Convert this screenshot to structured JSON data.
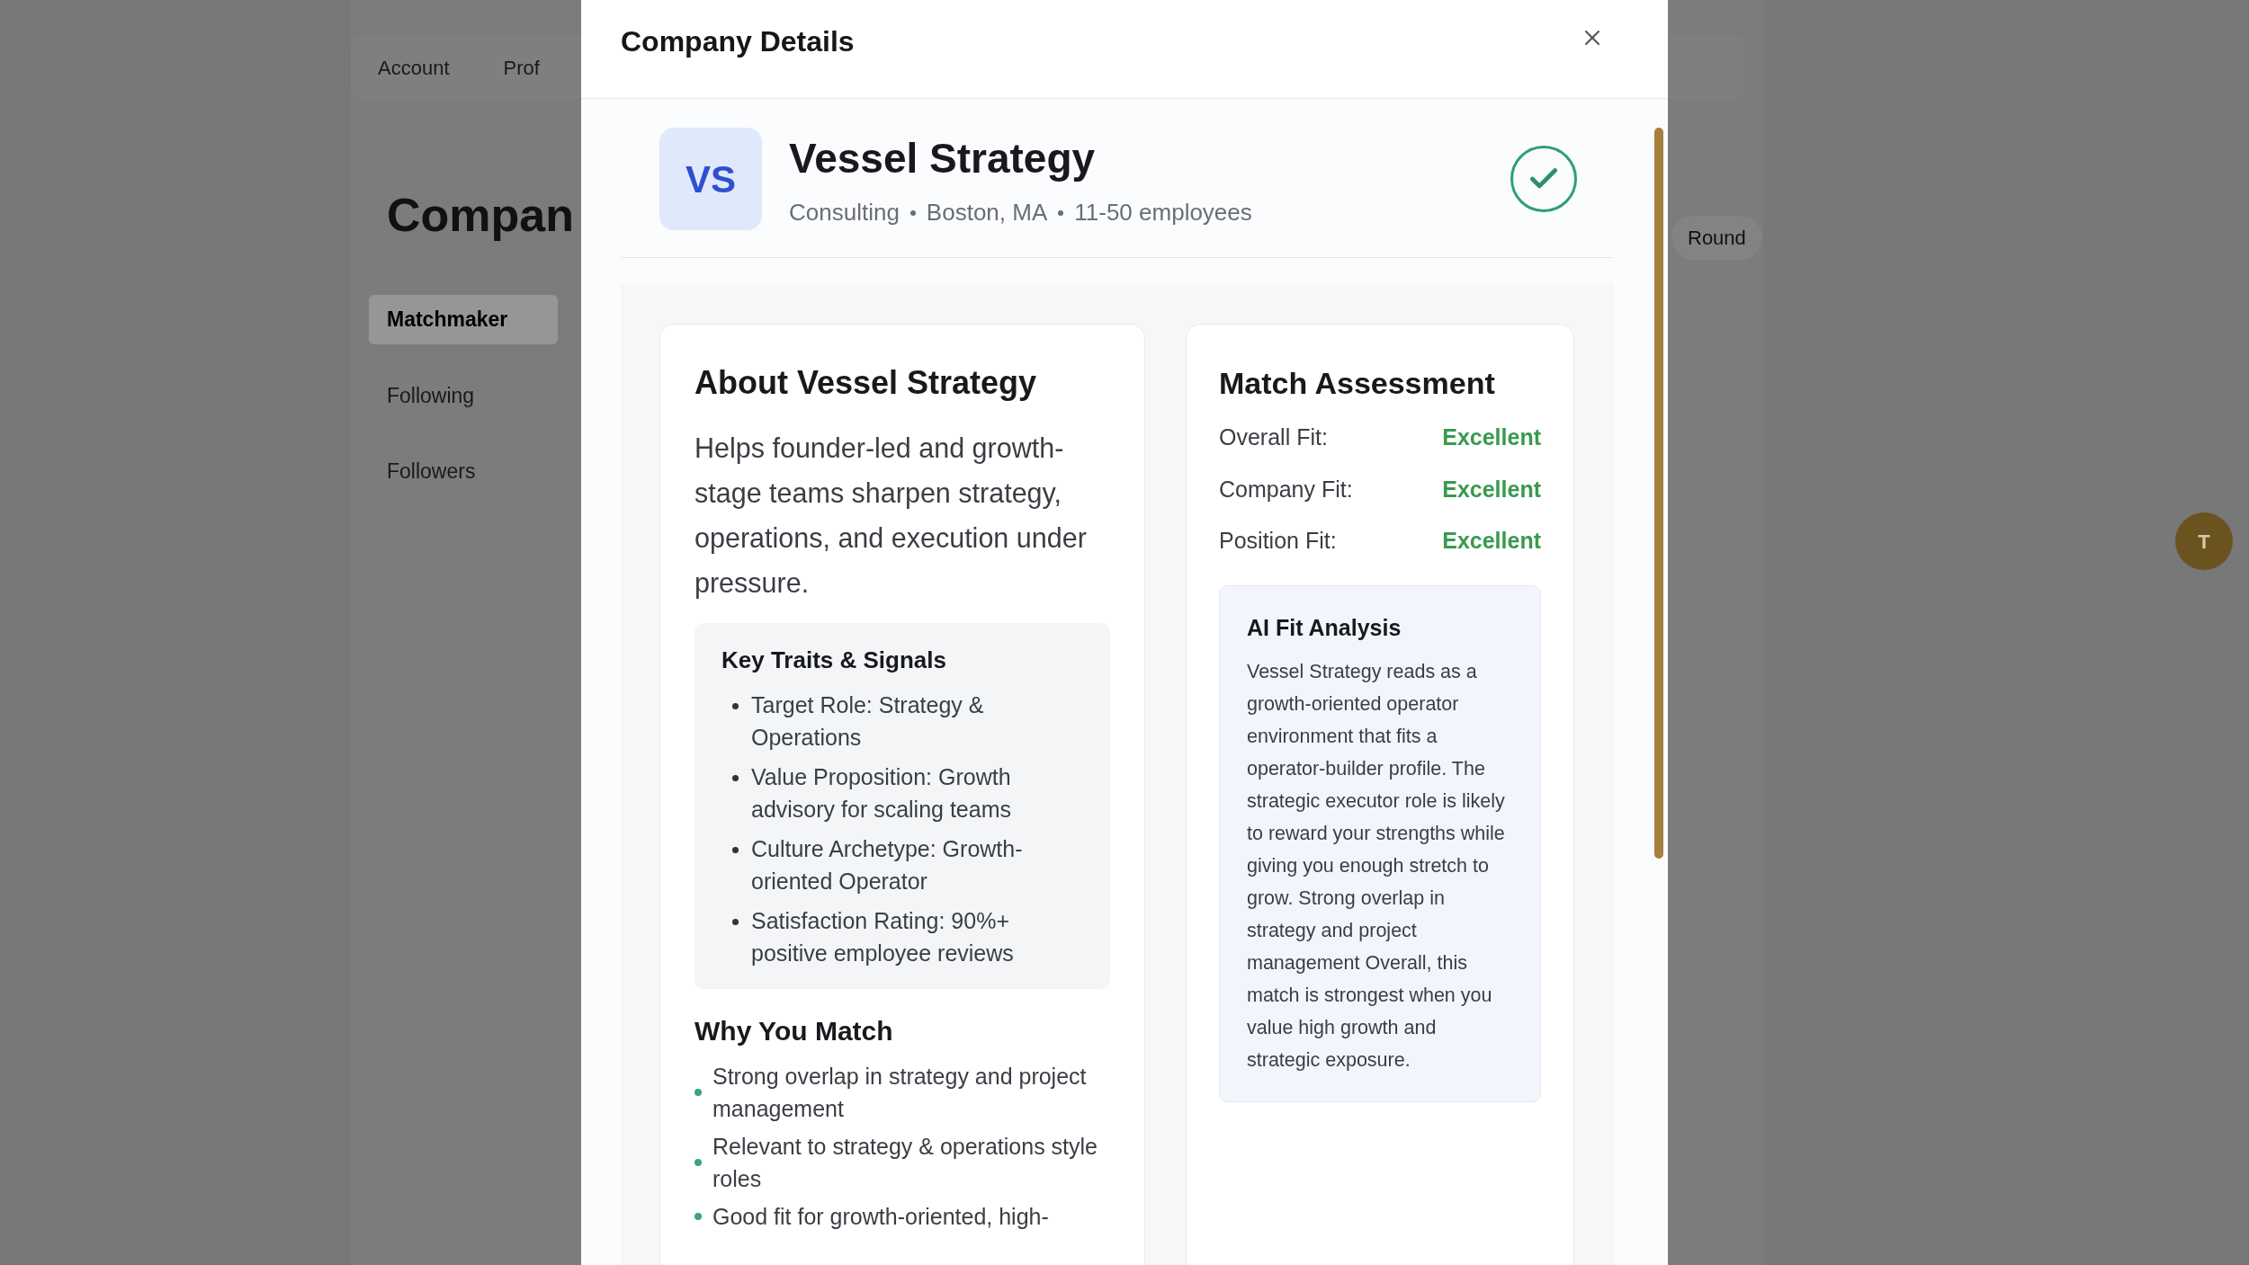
{
  "background": {
    "tabs": [
      {
        "label": "Account",
        "selected": false
      },
      {
        "label": "Prof",
        "selected": false
      }
    ],
    "heading": "Compan",
    "sidebar": [
      {
        "label": "Matchmaker",
        "selected": true
      },
      {
        "label": "Following",
        "selected": false
      },
      {
        "label": "Followers",
        "selected": false
      }
    ],
    "filter_chip": "Round",
    "avatar": "T"
  },
  "modal": {
    "title": "Company Details",
    "company": {
      "initials": "VS",
      "name": "Vessel Strategy",
      "meta": [
        "Consulting",
        "Boston, MA",
        "11-50 employees"
      ],
      "verified": true
    },
    "about": {
      "title": "About Vessel Strategy",
      "description": "Helps founder-led and growth-stage teams sharpen strategy, operations, and execution under pressure.",
      "traits_title": "Key Traits & Signals",
      "traits": [
        "Target Role: Strategy & Operations",
        "Value Proposition: Growth advisory for scaling teams",
        "Culture Archetype: Growth-oriented Operator",
        "Satisfaction Rating: 90%+ positive employee reviews"
      ],
      "why_title": "Why You Match",
      "why": [
        "Strong overlap in strategy and project management",
        "Relevant to strategy & operations style roles",
        "Good fit for growth-oriented, high-"
      ]
    },
    "assessment": {
      "title": "Match Assessment",
      "rows": [
        {
          "label": "Overall Fit:",
          "value": "Excellent"
        },
        {
          "label": "Company Fit:",
          "value": "Excellent"
        },
        {
          "label": "Position Fit:",
          "value": "Excellent"
        }
      ],
      "analysis": {
        "title": "AI Fit Analysis",
        "text": "Vessel Strategy reads as a growth-oriented operator environment that fits a operator-builder profile. The strategic executor role is likely to reward your strengths while giving you enough stretch to grow. Strong overlap in strategy and project management Overall, this match is strongest when you value high growth and strategic exposure."
      }
    }
  }
}
